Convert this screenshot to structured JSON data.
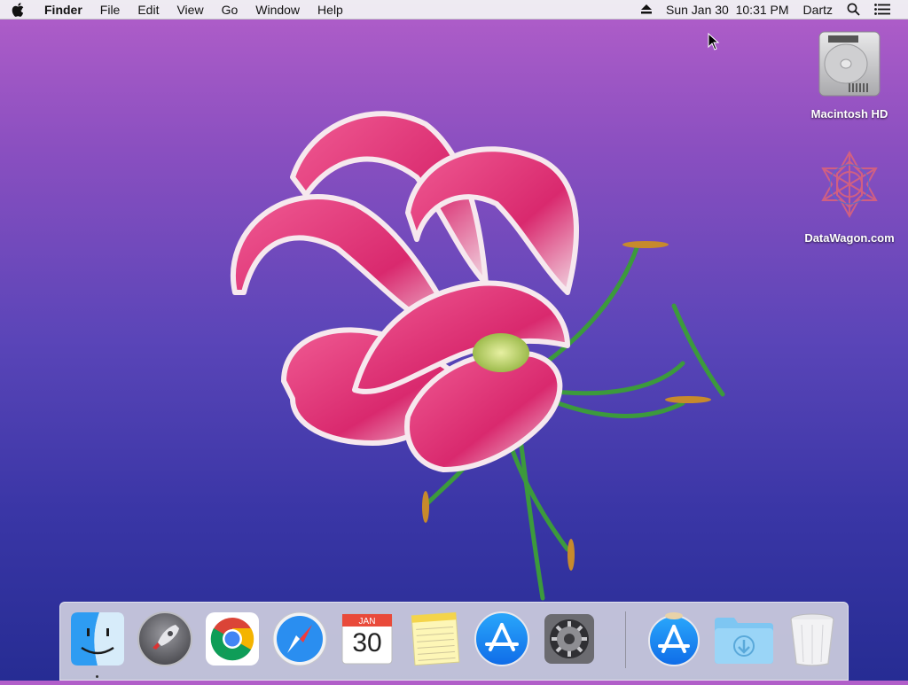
{
  "menubar": {
    "app_name": "Finder",
    "menus": [
      "File",
      "Edit",
      "View",
      "Go",
      "Window",
      "Help"
    ],
    "status": {
      "datetime": "Sun Jan 30  10:31 PM",
      "user": "Dartz"
    }
  },
  "desktop": {
    "icons": [
      {
        "label": "Macintosh HD",
        "icon": "hard-drive-icon"
      },
      {
        "label": "DataWagon.com",
        "icon": "datawagon-logo-icon"
      }
    ]
  },
  "dock": {
    "items": [
      {
        "name": "Finder",
        "icon": "finder-icon",
        "running": true
      },
      {
        "name": "Launchpad",
        "icon": "launchpad-icon"
      },
      {
        "name": "Google Chrome",
        "icon": "chrome-icon"
      },
      {
        "name": "Safari",
        "icon": "safari-icon"
      },
      {
        "name": "Calendar",
        "icon": "calendar-icon",
        "month": "JAN",
        "day": "30"
      },
      {
        "name": "Notes",
        "icon": "notes-icon"
      },
      {
        "name": "App Store",
        "icon": "app-store-icon"
      },
      {
        "name": "System Preferences",
        "icon": "system-preferences-icon"
      },
      {
        "name": "App Store",
        "icon": "app-store-icon"
      },
      {
        "name": "Downloads",
        "icon": "downloads-folder-icon"
      },
      {
        "name": "Trash",
        "icon": "trash-icon"
      }
    ]
  },
  "colors": {
    "wallpaper_top": "#b25ec9",
    "wallpaper_bottom": "#262c93",
    "flower_pink": "#e83a7e",
    "stem_green": "#3c9a3c",
    "app_store_blue": "#1f8ef5"
  }
}
